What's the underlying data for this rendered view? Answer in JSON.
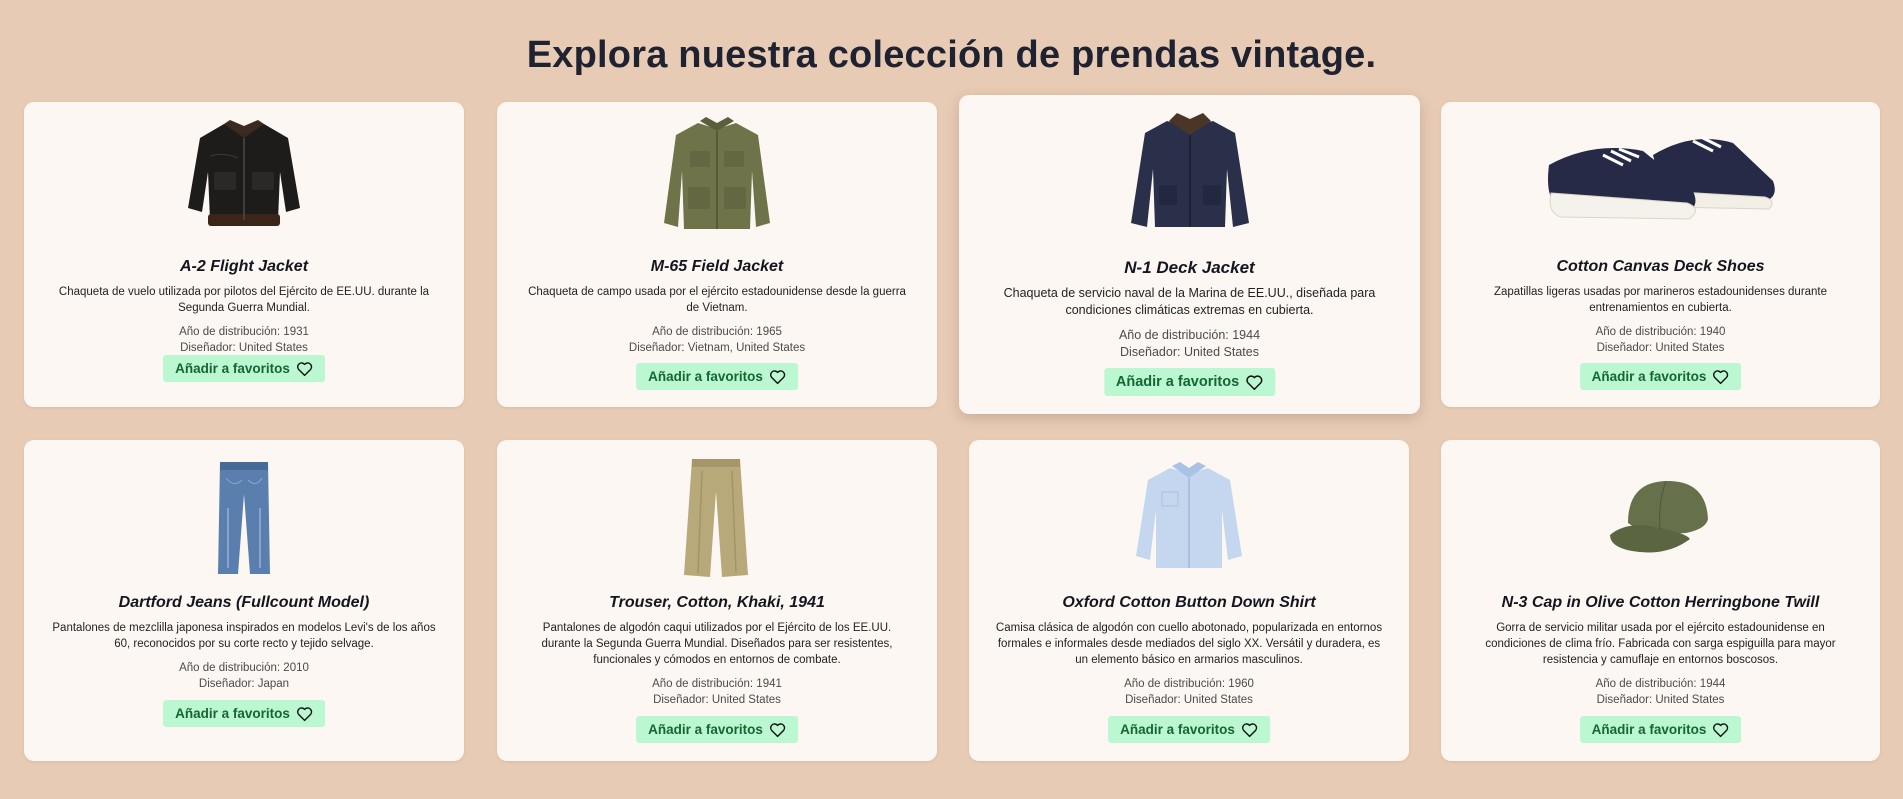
{
  "page": {
    "title": "Explora nuestra colección de prendas vintage."
  },
  "labels": {
    "fav_button": "Añadir a favoritos",
    "fav_icon": "heart-outline-icon"
  },
  "items": [
    {
      "name": "A-2 Flight Jacket",
      "description": "Chaqueta de vuelo utilizada por pilotos del Ejército de EE.UU. durante la Segunda Guerra Mundial.",
      "year": "Año de distribución: 1931",
      "designer": "Diseñador: United States",
      "image": "leather-flight-jacket"
    },
    {
      "name": "M-65 Field Jacket",
      "description": "Chaqueta de campo usada por el ejército estadounidense desde la guerra de Vietnam.",
      "year": "Año de distribución: 1965",
      "designer": "Diseñador: Vietnam, United States",
      "image": "olive-field-jacket"
    },
    {
      "name": "N-1 Deck Jacket",
      "description": "Chaqueta de servicio naval de la Marina de EE.UU., diseñada para condiciones climáticas extremas en cubierta.",
      "year": "Año de distribución: 1944",
      "designer": "Diseñador: United States",
      "image": "navy-deck-jacket"
    },
    {
      "name": "Cotton Canvas Deck Shoes",
      "description": "Zapatillas ligeras usadas por marineros estadounidenses durante entrenamientos en cubierta.",
      "year": "Año de distribución: 1940",
      "designer": "Diseñador: United States",
      "image": "navy-canvas-shoes"
    },
    {
      "name": "Dartford Jeans (Fullcount Model)",
      "description": "Pantalones de mezclilla japonesa inspirados en modelos Levi's de los años 60, reconocidos por su corte recto y tejido selvage.",
      "year": "Año de distribución: 2010",
      "designer": "Diseñador: Japan",
      "image": "blue-jeans"
    },
    {
      "name": "Trouser, Cotton, Khaki, 1941",
      "description": "Pantalones de algodón caqui utilizados por el Ejército de los EE.UU. durante la Segunda Guerra Mundial. Diseñados para ser resistentes, funcionales y cómodos en entornos de combate.",
      "year": "Año de distribución: 1941",
      "designer": "Diseñador: United States",
      "image": "khaki-trousers"
    },
    {
      "name": "Oxford Cotton Button Down Shirt",
      "description": "Camisa clásica de algodón con cuello abotonado, popularizada en entornos formales e informales desde mediados del siglo XX. Versátil y duradera, es un elemento básico en armarios masculinos.",
      "year": "Año de distribución: 1960",
      "designer": "Diseñador: United States",
      "image": "light-blue-shirt"
    },
    {
      "name": "N-3 Cap in Olive Cotton Herringbone Twill",
      "description": "Gorra de servicio militar usada por el ejército estadounidense en condiciones de clima frío. Fabricada con sarga espiguilla para mayor resistencia y camuflaje en entornos boscosos.",
      "year": "Año de distribución: 1944",
      "designer": "Diseñador: United States",
      "image": "olive-cap"
    }
  ]
}
